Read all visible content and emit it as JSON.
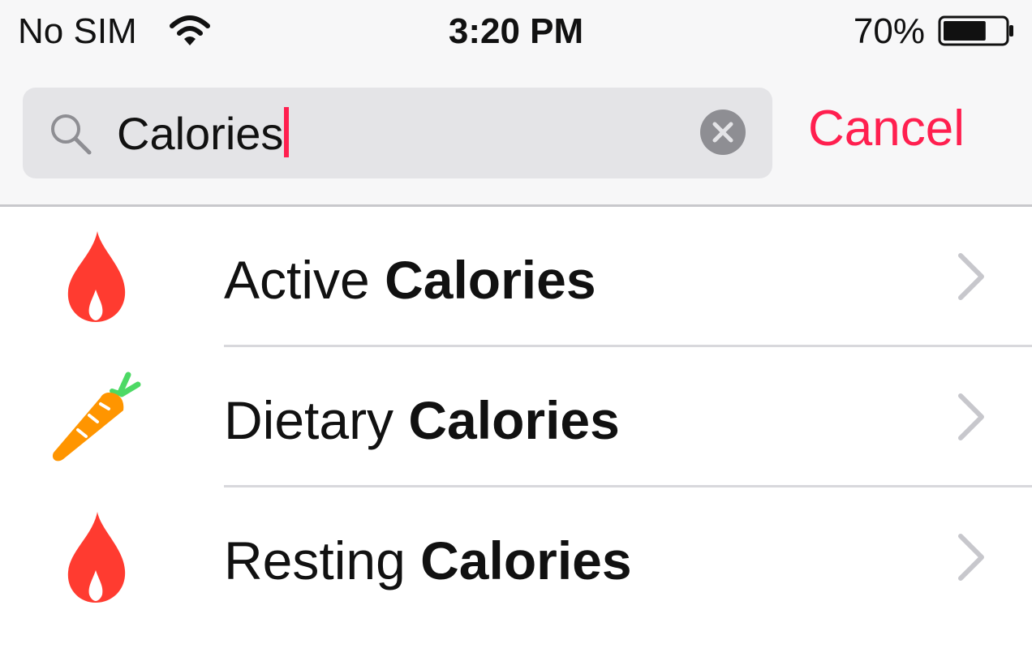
{
  "status_bar": {
    "carrier": "No SIM",
    "time": "3:20 PM",
    "battery_percent": "70%",
    "battery_level": 0.7,
    "wifi_icon": "wifi-icon",
    "battery_icon": "battery-icon"
  },
  "search": {
    "value": "Calories",
    "icon": "search-icon",
    "clear_icon": "clear-icon",
    "cancel_label": "Cancel"
  },
  "results": [
    {
      "prefix": "Active ",
      "match": "Calories",
      "icon": "flame-icon"
    },
    {
      "prefix": "Dietary ",
      "match": "Calories",
      "icon": "carrot-icon"
    },
    {
      "prefix": "Resting ",
      "match": "Calories",
      "icon": "flame-icon"
    }
  ],
  "colors": {
    "accent": "#ff1f4f",
    "flame": "#ff3b30",
    "carrot": "#ff9500",
    "carrot_leaves": "#4cd964",
    "chevron": "#c7c7cc",
    "search_field": "#e4e4e7"
  }
}
